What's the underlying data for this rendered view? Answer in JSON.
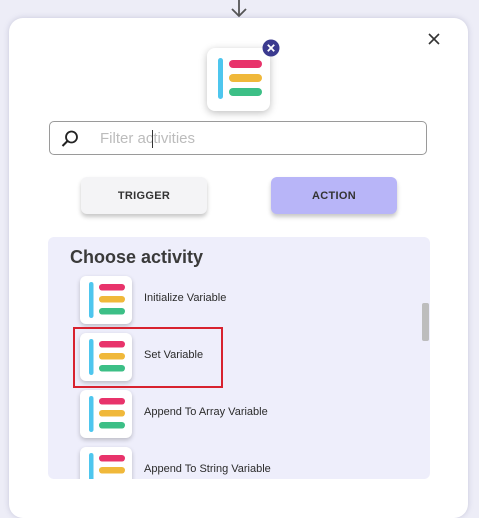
{
  "search": {
    "placeholder": "Filter activities"
  },
  "tabs": [
    {
      "label": "TRIGGER",
      "selected": false
    },
    {
      "label": "ACTION",
      "selected": true
    }
  ],
  "activity_list": {
    "title": "Choose activity",
    "items": [
      {
        "label": "Initialize Variable"
      },
      {
        "label": "Set Variable",
        "highlighted": true
      },
      {
        "label": "Append To Array Variable"
      },
      {
        "label": "Append To String Variable"
      }
    ]
  },
  "icons": {
    "top_arrow": "arrow-down-icon",
    "close": "close-icon",
    "logo_remove": "remove-badge-icon",
    "search": "search-icon",
    "activity": "variable-activity-icon"
  },
  "colors": {
    "action_tab": "#b8b5f8",
    "trigger_tab": "#f4f4f6",
    "list_background": "#eeeefb",
    "highlight_border": "#d8222f",
    "logo_pink": "#e8336b",
    "logo_yellow": "#f0b83a",
    "logo_green": "#3cbf86",
    "logo_blue": "#4ec6ee",
    "badge_navy": "#3b3a8f"
  }
}
